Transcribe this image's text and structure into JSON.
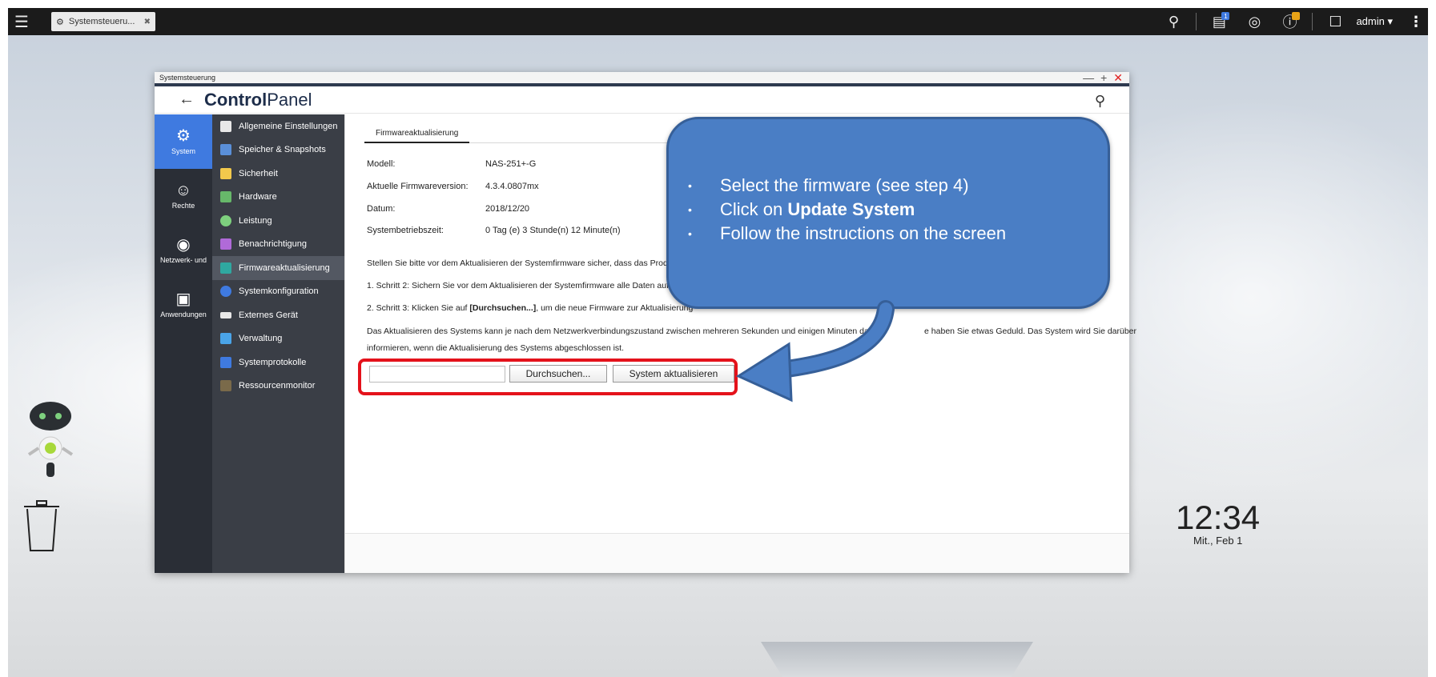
{
  "topbar": {
    "task_tab_label": "Systemsteueru...",
    "user": "admin",
    "notification_badge": "1"
  },
  "window": {
    "title": "Systemsteuerung",
    "app_title_bold": "Control",
    "app_title_rest": "Panel"
  },
  "nav": [
    {
      "label": "System",
      "icon": "gear-icon"
    },
    {
      "label": "Rechte",
      "icon": "user-icon"
    },
    {
      "label": "Netzwerk- und",
      "icon": "globe-icon"
    },
    {
      "label": "Anwendungen",
      "icon": "apps-icon"
    }
  ],
  "submenu": [
    {
      "label": "Allgemeine Einstellungen",
      "color": "#e8e8e8"
    },
    {
      "label": "Speicher & Snapshots",
      "color": "#5a8fd8"
    },
    {
      "label": "Sicherheit",
      "color": "#f2c94c"
    },
    {
      "label": "Hardware",
      "color": "#67b86a"
    },
    {
      "label": "Leistung",
      "color": "#7ed07e"
    },
    {
      "label": "Benachrichtigung",
      "color": "#b06ad8"
    },
    {
      "label": "Firmwareaktualisierung",
      "color": "#2fa8a0"
    },
    {
      "label": "Systemkonfiguration",
      "color": "#3f7ae0"
    },
    {
      "label": "Externes Gerät",
      "color": "#e8e8e8"
    },
    {
      "label": "Verwaltung",
      "color": "#4aa4e8"
    },
    {
      "label": "Systemprotokolle",
      "color": "#3f7ae0"
    },
    {
      "label": "Ressourcenmonitor",
      "color": "#7a6a4a"
    }
  ],
  "content": {
    "tab": "Firmwareaktualisierung",
    "info": [
      {
        "label": "Modell:",
        "value": "NAS-251+-G"
      },
      {
        "label": "Aktuelle Firmwareversion:",
        "value": "4.3.4.0807mx"
      },
      {
        "label": "Datum:",
        "value": "2018/12/20"
      },
      {
        "label": "Systembetriebszeit:",
        "value": "0 Tag (e) 3 Stunde(n) 12 Minute(n)"
      }
    ],
    "para1": "Stellen Sie bitte vor dem Aktualisieren der Systemfirmware sicher, dass das Produ",
    "step1": "1. Schritt 2: Sichern Sie vor dem Aktualisieren der Systemfirmware alle Daten auf",
    "step2_a": "2. Schritt 3: Klicken Sie auf ",
    "step2_b": "[Durchsuchen...]",
    "step2_c": ", um die neue Firmware zur Aktualisierung",
    "para2_a": "Das Aktualisieren des Systems kann je nach dem Netzwerkverbindungszustand zwischen mehreren Sekunden und einigen Minuten dauer",
    "para2_b": "e haben Sie etwas Geduld. Das System wird Sie darüber",
    "para2_c": "informieren, wenn die Aktualisierung des Systems abgeschlossen ist.",
    "browse_button": "Durchsuchen...",
    "update_button": "System aktualisieren"
  },
  "callout": {
    "line1": "Select the firmware (see step 4)",
    "line2_a": "Click on ",
    "line2_b": "Update System",
    "line3": "Follow the instructions on the screen"
  },
  "desktop": {
    "clock": "12:34",
    "date": "Mit., Feb 1"
  }
}
